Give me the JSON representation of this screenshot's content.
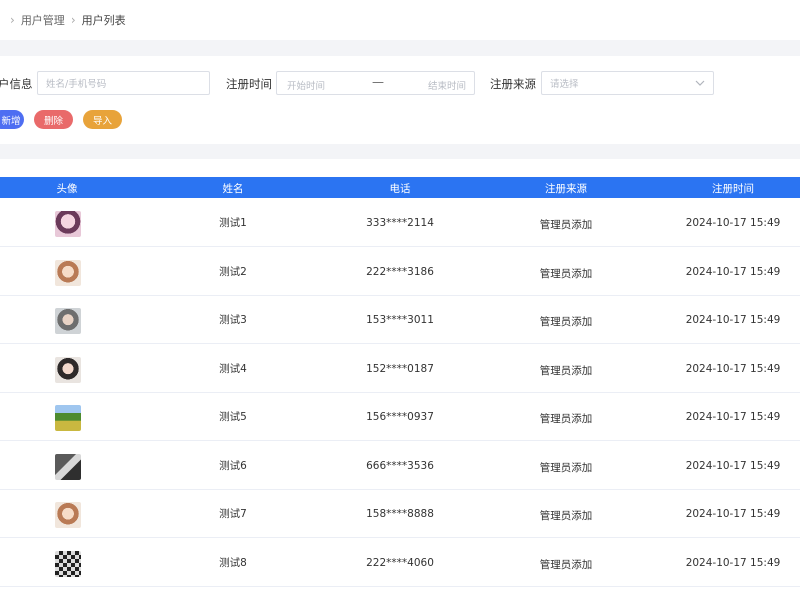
{
  "breadcrumb": {
    "parent": "用户管理",
    "current": "用户列表"
  },
  "filters": {
    "user_info_label": "户信息",
    "user_info_placeholder": "姓名/手机号码",
    "reg_time_label": "注册时间",
    "start_placeholder": "开始时间",
    "range_sep": "—",
    "end_placeholder": "结束时间",
    "source_label": "注册来源",
    "source_placeholder": "请选择"
  },
  "actions": {
    "add": "新增",
    "delete": "删除",
    "import": "导入"
  },
  "table": {
    "headers": {
      "avatar": "头像",
      "name": "姓名",
      "phone": "电话",
      "source": "注册来源",
      "time": "注册时间"
    },
    "rows": [
      {
        "name": "测试1",
        "phone": "333****2114",
        "source": "管理员添加",
        "time": "2024-10-17  15:49"
      },
      {
        "name": "测试2",
        "phone": "222****3186",
        "source": "管理员添加",
        "time": "2024-10-17  15:49"
      },
      {
        "name": "测试3",
        "phone": "153****3011",
        "source": "管理员添加",
        "time": "2024-10-17  15:49"
      },
      {
        "name": "测试4",
        "phone": "152****0187",
        "source": "管理员添加",
        "time": "2024-10-17  15:49"
      },
      {
        "name": "测试5",
        "phone": "156****0937",
        "source": "管理员添加",
        "time": "2024-10-17  15:49"
      },
      {
        "name": "测试6",
        "phone": "666****3536",
        "source": "管理员添加",
        "time": "2024-10-17  15:49"
      },
      {
        "name": "测试7",
        "phone": "158****8888",
        "source": "管理员添加",
        "time": "2024-10-17  15:49"
      },
      {
        "name": "测试8",
        "phone": "222****4060",
        "source": "管理员添加",
        "time": "2024-10-17  15:49"
      }
    ]
  },
  "colors": {
    "primary": "#2b74f2",
    "add": "#4e6ef2",
    "delete": "#e96a6a",
    "import": "#e8a33a"
  }
}
